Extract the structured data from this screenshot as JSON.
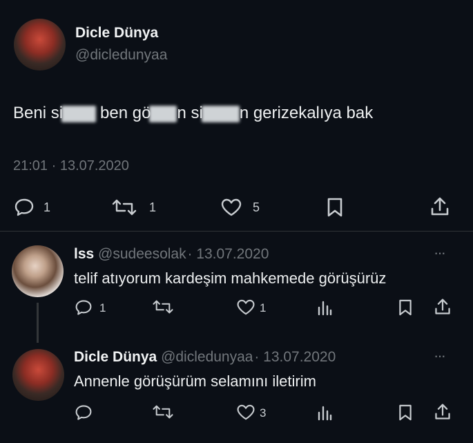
{
  "tweet": {
    "author_name": "Dicle Dünya",
    "author_handle": "@dicledunyaa",
    "text_parts": [
      "Beni si",
      "ben gö",
      "n si",
      "n gerizekalıya bak"
    ],
    "timestamp": "21:01 · 13.07.2020",
    "reply_count": "1",
    "retweet_count": "1",
    "like_count": "5"
  },
  "replies": [
    {
      "author_name": "lss",
      "author_handle": "@sudeesolak",
      "date": "· 13.07.2020",
      "text": "telif atıyorum kardeşim mahkemede görüşürüz",
      "reply_count": "1",
      "like_count": "1"
    },
    {
      "author_name": "Dicle Dünya",
      "author_handle": "@dicledunyaa",
      "date": "· 13.07.2020",
      "text": "Annenle görüşürüm selamını iletirim",
      "like_count": "3"
    }
  ],
  "more_label": "···"
}
